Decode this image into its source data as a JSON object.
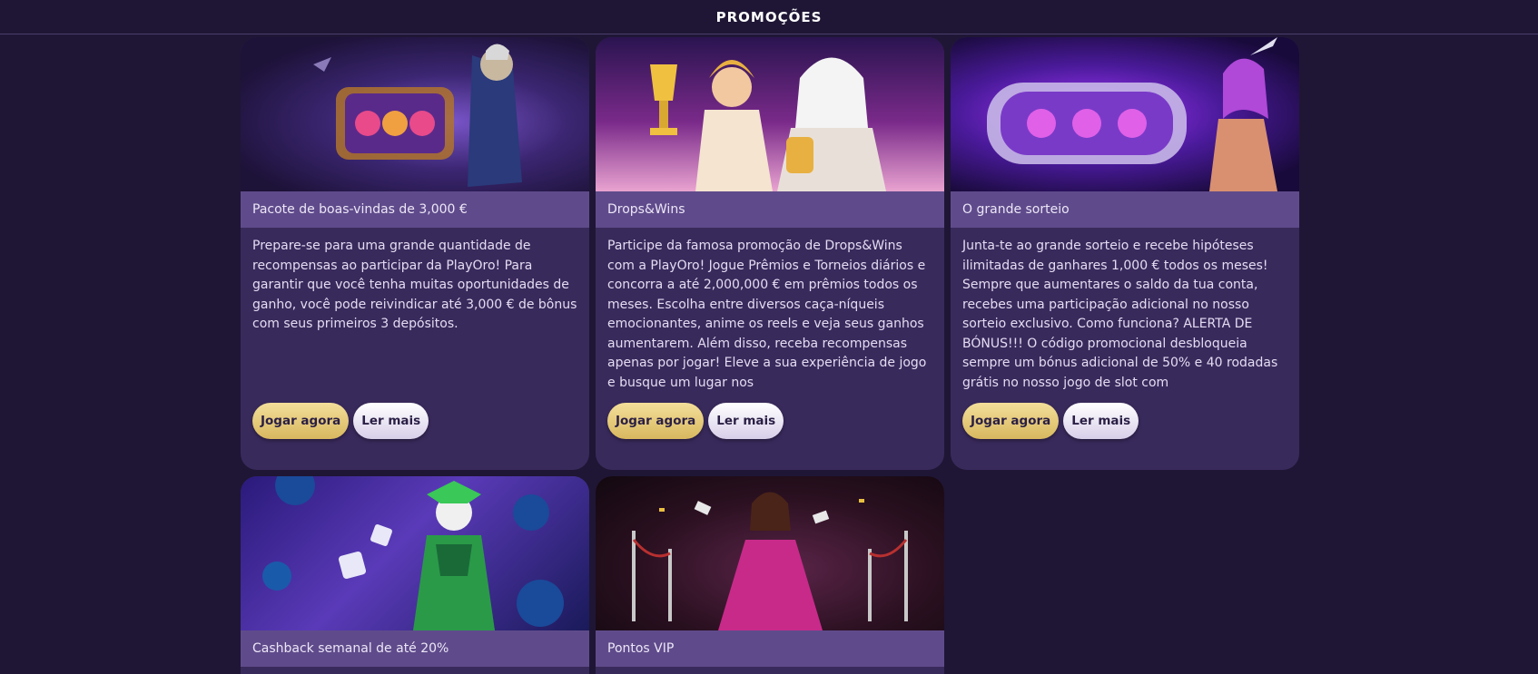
{
  "header": {
    "title": "PROMOÇÕES"
  },
  "promotions": [
    {
      "title": "Pacote de boas-vindas de 3,000 €",
      "description": "Prepare-se para uma grande quantidade de recompensas ao participar da PlayOro! Para garantir que você tenha muitas oportunidades de ganho, você pode reivindicar até 3,000 € de bônus com seus primeiros 3 depósitos.",
      "play_label": "Jogar agora",
      "more_label": "Ler mais"
    },
    {
      "title": "Drops&Wins",
      "description": "Participe da famosa promoção de Drops&Wins com a PlayOro! Jogue Prêmios e Torneios diários e concorra a até 2,000,000 € em prêmios todos os meses. Escolha entre diversos caça-níqueis emocionantes, anime os reels e veja seus ganhos aumentarem.  Além disso, receba recompensas apenas por jogar! Eleve a sua experiência de jogo e busque um lugar nos",
      "play_label": "Jogar agora",
      "more_label": "Ler mais"
    },
    {
      "title": "O grande sorteio",
      "description": "Junta-te ao grande sorteio e recebe hipóteses ilimitadas de ganhares 1,000 € todos os meses! Sempre que aumentares o saldo da tua conta, recebes uma participação adicional no nosso sorteio exclusivo.  Como funciona? ALERTA DE BÓNUS!!! O código promocional desbloqueia sempre um bónus adicional de 50% e 40 rodadas grátis no nosso jogo de slot com",
      "play_label": "Jogar agora",
      "more_label": "Ler mais"
    },
    {
      "title": "Cashback semanal de até 20%"
    },
    {
      "title": "Pontos VIP"
    }
  ],
  "colors": {
    "page_bg": "#1f1635",
    "card_bg": "#392a5c",
    "title_bar": "#5f4b8b",
    "play_button": "#e6c873",
    "more_button": "#ece6f7"
  }
}
